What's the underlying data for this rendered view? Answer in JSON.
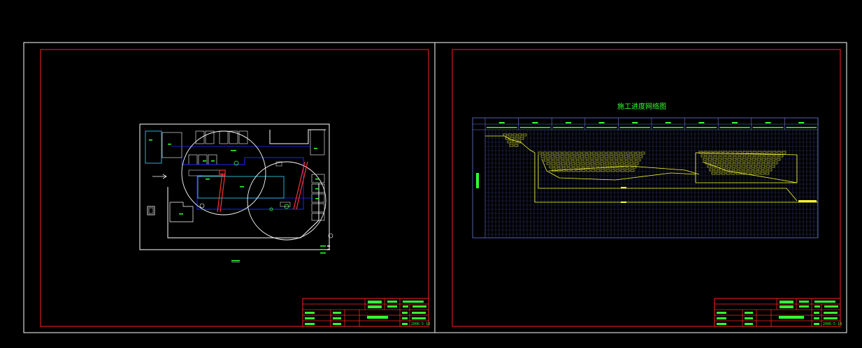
{
  "drawing": {
    "background_color": "#000000",
    "sheets": [
      {
        "id": "site-layout-sheet"
      },
      {
        "id": "network-schedule-sheet"
      }
    ],
    "network_schedule": {
      "title": "施工进度网络图"
    },
    "title_block": {
      "date_left": "2006-5-18",
      "date_right": "2006-5-18"
    },
    "colors": {
      "sheet_border": "#ffffff",
      "inner_frame": "#ff2020",
      "text": "#33ff33",
      "grid": "#3a4a8a",
      "schedule_bars": "#ffff33",
      "crane_radius": "#ffffff",
      "building_outline": "#1a2aff",
      "tower_crane": "#ff3030"
    }
  }
}
